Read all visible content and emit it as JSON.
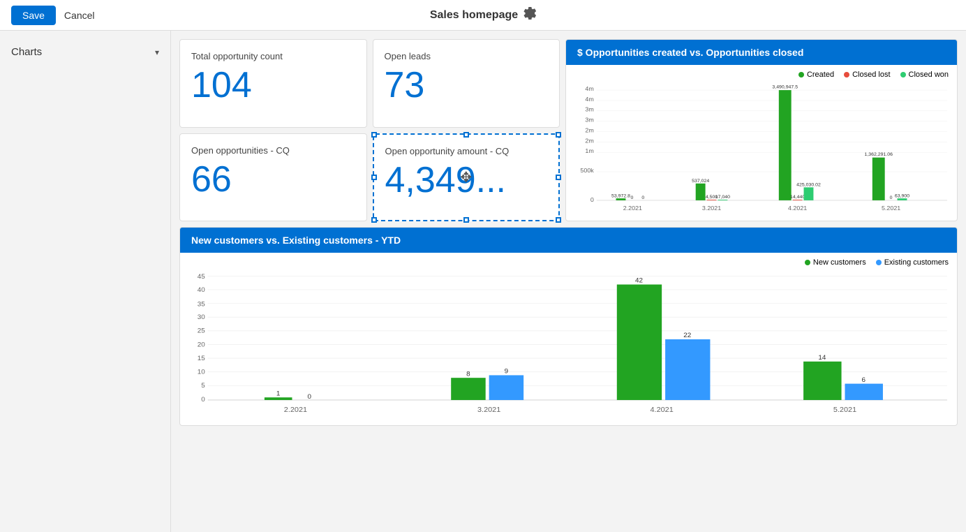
{
  "topbar": {
    "save_label": "Save",
    "cancel_label": "Cancel",
    "title": "Sales homepage",
    "gear_title": "Settings"
  },
  "sidebar": {
    "label": "Charts",
    "chevron": "▾"
  },
  "kpi_cards": [
    {
      "id": "total-opp-count",
      "label": "Total opportunity count",
      "value": "104",
      "selected": false
    },
    {
      "id": "open-leads",
      "label": "Open leads",
      "value": "73",
      "selected": false
    },
    {
      "id": "open-opp-cq",
      "label": "Open opportunities - CQ",
      "value": "66",
      "selected": false
    },
    {
      "id": "open-opp-amount-cq",
      "label": "Open opportunity amount - CQ",
      "value": "4,349...",
      "selected": true
    }
  ],
  "opp_chart": {
    "title": "$ Opportunities created vs. Opportunities closed",
    "legend": [
      {
        "label": "Created",
        "color": "#22a422"
      },
      {
        "label": "Closed lost",
        "color": "#e74c3c"
      },
      {
        "label": "Closed won",
        "color": "#2ecc71"
      }
    ],
    "y_labels": [
      "4m",
      "4m",
      "3m",
      "3m",
      "2m",
      "2m",
      "1m",
      "500k",
      "0"
    ],
    "x_labels": [
      "2.2021",
      "3.2021",
      "4.2021",
      "5.2021"
    ],
    "groups": [
      {
        "x_label": "2.2021",
        "bars": [
          {
            "label": "Created",
            "value": 53972.8,
            "display": "53,972.8",
            "color": "#22a422"
          },
          {
            "label": "Closed lost",
            "value": 0,
            "display": "0",
            "color": "#e74c3c"
          },
          {
            "label": "Closed won",
            "value": 0,
            "display": "0",
            "color": "#2ecc71"
          }
        ]
      },
      {
        "x_label": "3.2021",
        "bars": [
          {
            "label": "Created",
            "value": 537024,
            "display": "537,024",
            "color": "#22a422"
          },
          {
            "label": "Closed lost",
            "value": 4500,
            "display": "4,500",
            "color": "#e74c3c"
          },
          {
            "label": "Closed won",
            "value": 17040,
            "display": "17,040",
            "color": "#2ecc71"
          }
        ]
      },
      {
        "x_label": "4.2021",
        "bars": [
          {
            "label": "Created",
            "value": 3490947.5,
            "display": "3,490,947.5",
            "color": "#22a422"
          },
          {
            "label": "Closed lost",
            "value": 14440,
            "display": "14,440",
            "color": "#e74c3c"
          },
          {
            "label": "Closed won",
            "value": 425030.02,
            "display": "425,030.02",
            "color": "#2ecc71"
          }
        ]
      },
      {
        "x_label": "5.2021",
        "bars": [
          {
            "label": "Created",
            "value": 1362291.06,
            "display": "1,362,291.06",
            "color": "#22a422"
          },
          {
            "label": "Closed lost",
            "value": 0,
            "display": "0",
            "color": "#e74c3c"
          },
          {
            "label": "Closed won",
            "value": 63900,
            "display": "63,900",
            "color": "#2ecc71"
          }
        ]
      }
    ]
  },
  "customers_chart": {
    "title": "New customers vs. Existing customers - YTD",
    "legend": [
      {
        "label": "New customers",
        "color": "#22a422"
      },
      {
        "label": "Existing customers",
        "color": "#3399ff"
      }
    ],
    "y_max": 45,
    "y_labels": [
      "45",
      "40",
      "35",
      "30",
      "25",
      "20",
      "15",
      "10",
      "5",
      "0"
    ],
    "x_labels": [
      "2.2021",
      "3.2021",
      "4.2021",
      "5.2021"
    ],
    "groups": [
      {
        "x_label": "2.2021",
        "new_val": 1,
        "existing_val": 0
      },
      {
        "x_label": "3.2021",
        "new_val": 8,
        "existing_val": 9
      },
      {
        "x_label": "4.2021",
        "new_val": 42,
        "existing_val": 22
      },
      {
        "x_label": "5.2021",
        "new_val": 14,
        "existing_val": 6
      }
    ]
  }
}
